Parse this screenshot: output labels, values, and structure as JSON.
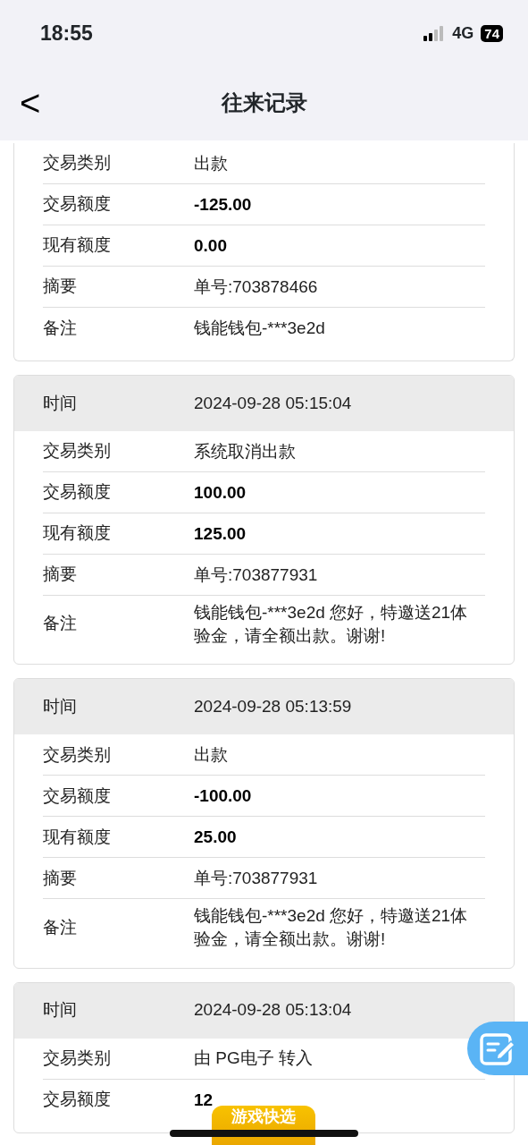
{
  "status_bar": {
    "time": "18:55",
    "network": "4G",
    "battery": "74"
  },
  "nav": {
    "back": "<",
    "title": "往来记录"
  },
  "records": [
    {
      "fields": [
        {
          "label": "交易类别",
          "value": "出款",
          "bold": false
        },
        {
          "label": "交易额度",
          "value": "-125.00",
          "bold": true
        },
        {
          "label": "现有额度",
          "value": "0.00",
          "bold": true
        },
        {
          "label": "摘要",
          "value": "单号:703878466",
          "bold": false
        },
        {
          "label": "备注",
          "value": "钱能钱包-***3e2d",
          "bold": false
        }
      ]
    },
    {
      "time_label": "时间",
      "time": "2024-09-28 05:15:04",
      "fields": [
        {
          "label": "交易类别",
          "value": "系统取消出款",
          "bold": false
        },
        {
          "label": "交易额度",
          "value": "100.00",
          "bold": true
        },
        {
          "label": "现有额度",
          "value": "125.00",
          "bold": true
        },
        {
          "label": "摘要",
          "value": "单号:703877931",
          "bold": false
        },
        {
          "label": "备注",
          "value": "钱能钱包-***3e2d 您好，特邀送21体验金，请全额出款。谢谢!",
          "bold": false
        }
      ]
    },
    {
      "time_label": "时间",
      "time": "2024-09-28 05:13:59",
      "fields": [
        {
          "label": "交易类别",
          "value": "出款",
          "bold": false
        },
        {
          "label": "交易额度",
          "value": "-100.00",
          "bold": true
        },
        {
          "label": "现有额度",
          "value": "25.00",
          "bold": true
        },
        {
          "label": "摘要",
          "value": "单号:703877931",
          "bold": false
        },
        {
          "label": "备注",
          "value": "钱能钱包-***3e2d 您好，特邀送21体验金，请全额出款。谢谢!",
          "bold": false
        }
      ]
    },
    {
      "time_label": "时间",
      "time": "2024-09-28 05:13:04",
      "fields": [
        {
          "label": "交易类别",
          "value": "由 PG电子 转入",
          "bold": false
        },
        {
          "label": "交易额度",
          "value": "12",
          "bold": true
        }
      ]
    }
  ],
  "quick_button": "游戏快选"
}
